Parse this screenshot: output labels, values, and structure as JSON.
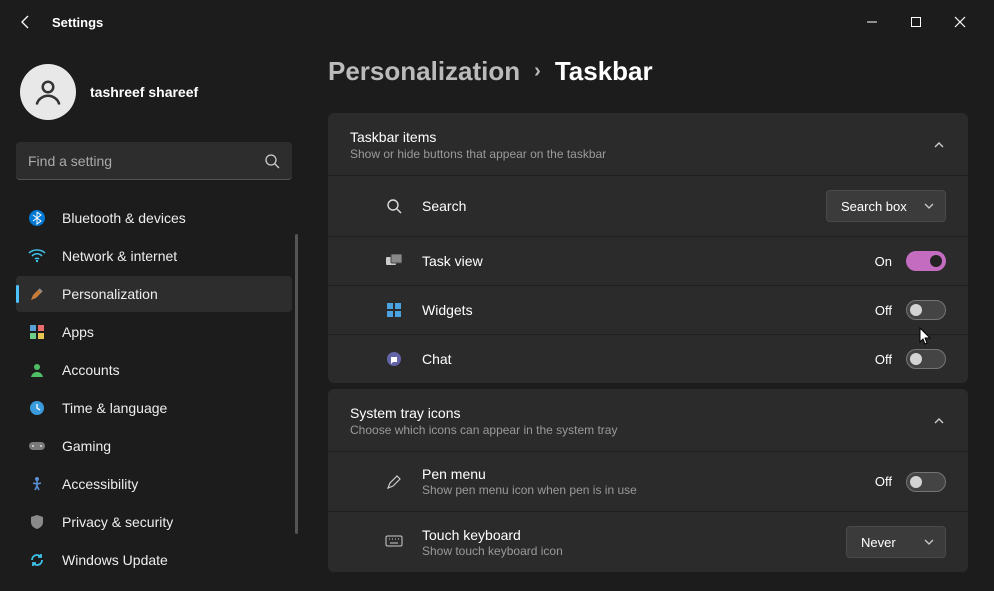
{
  "window": {
    "title": "Settings"
  },
  "user": {
    "name": "tashreef shareef"
  },
  "search": {
    "placeholder": "Find a setting"
  },
  "sidebar": {
    "items": [
      {
        "label": "Bluetooth & devices"
      },
      {
        "label": "Network & internet"
      },
      {
        "label": "Personalization"
      },
      {
        "label": "Apps"
      },
      {
        "label": "Accounts"
      },
      {
        "label": "Time & language"
      },
      {
        "label": "Gaming"
      },
      {
        "label": "Accessibility"
      },
      {
        "label": "Privacy & security"
      },
      {
        "label": "Windows Update"
      }
    ]
  },
  "breadcrumb": {
    "parent": "Personalization",
    "current": "Taskbar"
  },
  "groups": [
    {
      "title": "Taskbar items",
      "subtitle": "Show or hide buttons that appear on the taskbar",
      "rows": [
        {
          "title": "Search",
          "dropdown": "Search box"
        },
        {
          "title": "Task view",
          "state": "On",
          "toggle": true
        },
        {
          "title": "Widgets",
          "state": "Off",
          "toggle": false
        },
        {
          "title": "Chat",
          "state": "Off",
          "toggle": false
        }
      ]
    },
    {
      "title": "System tray icons",
      "subtitle": "Choose which icons can appear in the system tray",
      "rows": [
        {
          "title": "Pen menu",
          "subtitle": "Show pen menu icon when pen is in use",
          "state": "Off",
          "toggle": false
        },
        {
          "title": "Touch keyboard",
          "subtitle": "Show touch keyboard icon",
          "dropdown": "Never"
        }
      ]
    }
  ]
}
